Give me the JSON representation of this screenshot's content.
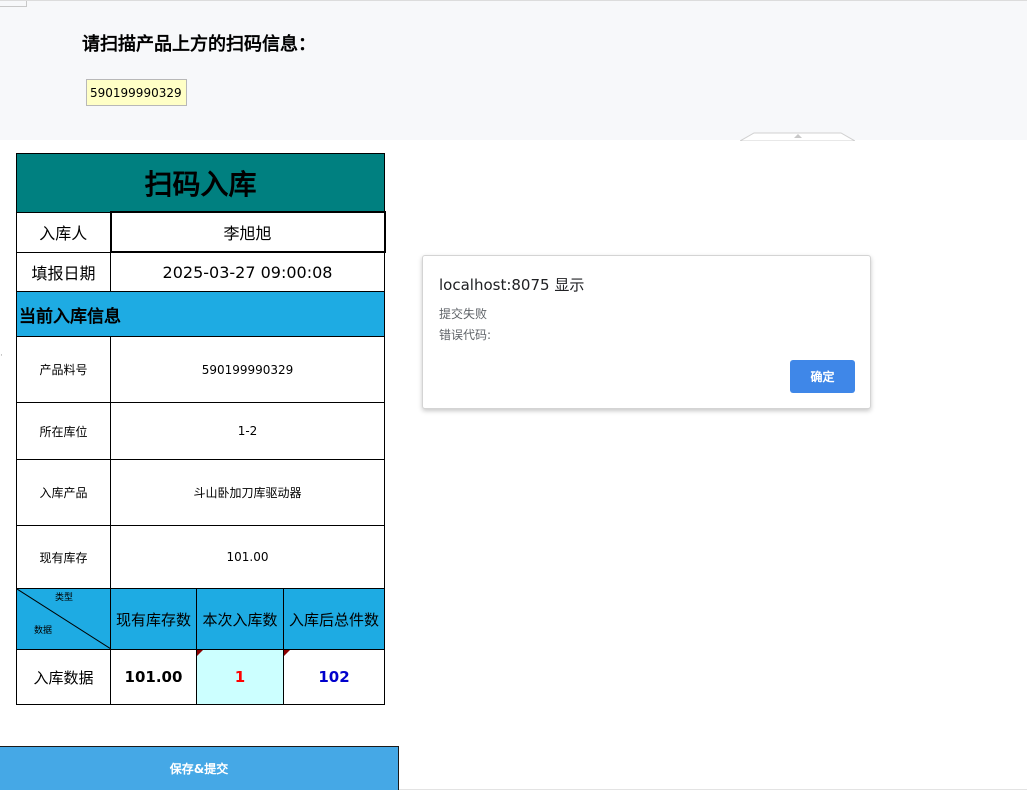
{
  "scan": {
    "title": "请扫描产品上方的扫码信息：",
    "input_value": "590199990329"
  },
  "form": {
    "title": "扫码入库",
    "operator_label": "入库人",
    "operator_value": "李旭旭",
    "date_label": "填报日期",
    "date_value": "2025-03-27 09:00:08",
    "section_title": "当前入库信息",
    "fields": [
      {
        "label": "产品料号",
        "value": "590199990329"
      },
      {
        "label": "所在库位",
        "value": "1-2"
      },
      {
        "label": "入库产品",
        "value": "斗山卧加刀库驱动器"
      },
      {
        "label": "现有库存",
        "value": "101.00"
      }
    ],
    "diag_top": "类型",
    "diag_bottom": "数据",
    "col_headers": [
      "现有库存数",
      "本次入库数",
      "入库后总件数"
    ],
    "data_row_label": "入库数据",
    "current_stock": "101.00",
    "input_qty": "1",
    "total_qty": "102",
    "save_label": "保存&提交"
  },
  "dialog": {
    "title": "localhost:8075 显示",
    "line1": "提交失败",
    "line2": "错误代码:",
    "ok_label": "确定"
  }
}
